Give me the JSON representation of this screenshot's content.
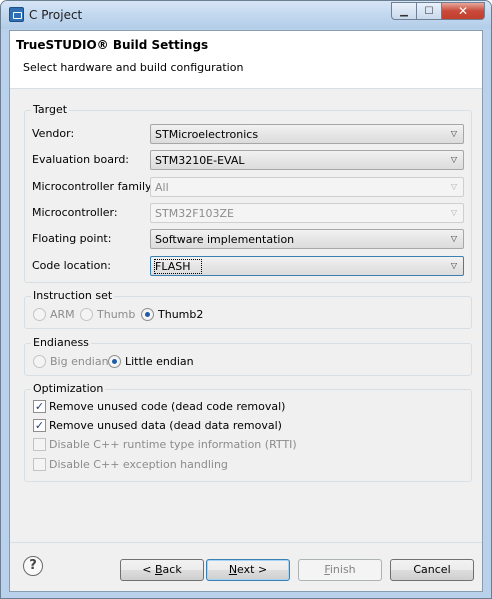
{
  "window": {
    "title": "C Project",
    "controls": {
      "minimize": "▁",
      "maximize": "☐",
      "close": "✕"
    }
  },
  "header": {
    "title": "TrueSTUDIO® Build Settings",
    "description": "Select hardware and build configuration"
  },
  "target": {
    "label": "Target",
    "fields": [
      {
        "label": "Vendor:",
        "value": "STMicroelectronics",
        "enabled": true
      },
      {
        "label": "Evaluation board:",
        "value": "STM3210E-EVAL",
        "enabled": true
      },
      {
        "label": "Microcontroller family:",
        "value": "All",
        "enabled": false
      },
      {
        "label": "Microcontroller:",
        "value": "STM32F103ZE",
        "enabled": false
      },
      {
        "label": "Floating point:",
        "value": "Software implementation",
        "enabled": true
      },
      {
        "label": "Code location:",
        "value": "FLASH",
        "enabled": true
      }
    ]
  },
  "instruction_set": {
    "label": "Instruction set",
    "options": [
      {
        "label": "ARM",
        "checked": false,
        "enabled": false
      },
      {
        "label": "Thumb",
        "checked": false,
        "enabled": false
      },
      {
        "label": "Thumb2",
        "checked": true,
        "enabled": true
      }
    ]
  },
  "endianess": {
    "label": "Endianess",
    "options": [
      {
        "label": "Big endian",
        "checked": false,
        "enabled": false
      },
      {
        "label": "Little endian",
        "checked": true,
        "enabled": true
      }
    ]
  },
  "optimization": {
    "label": "Optimization",
    "options": [
      {
        "label": "Remove unused code (dead code removal)",
        "checked": true,
        "enabled": true
      },
      {
        "label": "Remove unused data (dead data removal)",
        "checked": true,
        "enabled": true
      },
      {
        "label": "Disable C++ runtime type information (RTTI)",
        "checked": false,
        "enabled": false
      },
      {
        "label": "Disable C++ exception handling",
        "checked": false,
        "enabled": false
      }
    ]
  },
  "buttons": {
    "help": "?",
    "back_prefix": "< ",
    "back_mnemonic": "B",
    "back_rest": "ack",
    "next_mnemonic": "N",
    "next_rest": "ext >",
    "finish_mnemonic": "F",
    "finish_rest": "inish",
    "cancel": "Cancel"
  },
  "icons": {
    "chevron": "▽",
    "check": "✓"
  }
}
